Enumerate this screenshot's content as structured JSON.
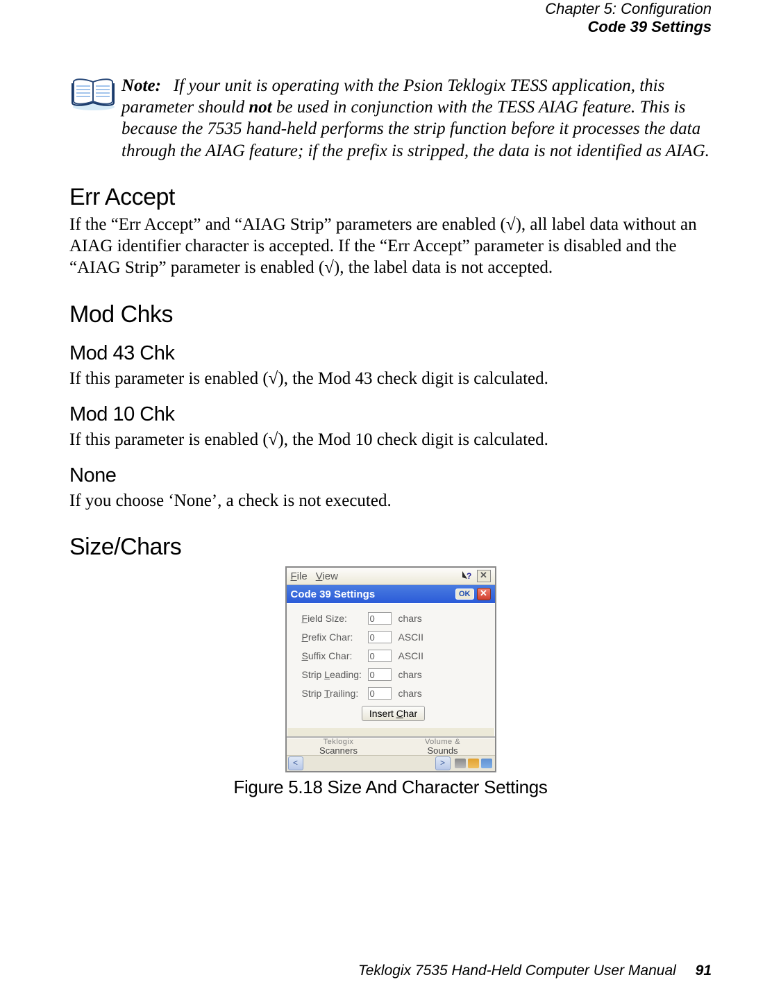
{
  "header": {
    "chapter": "Chapter 5: Configuration",
    "section": "Code 39 Settings"
  },
  "note": {
    "label": "Note:",
    "text_pre": "If your unit is operating with the Psion Teklogix TESS application, this parameter should ",
    "text_bold": "not",
    "text_post": " be used in conjunction with the TESS AIAG feature. This is because the 7535 hand-held performs the strip function before it processes the data through the AIAG feature; if the prefix is stripped, the data is not identified as AIAG."
  },
  "sections": {
    "err_accept": {
      "title": "Err Accept",
      "body": "If the “Err Accept” and “AIAG Strip” parameters are enabled (√), all label data without an AIAG identifier character is accepted. If the “Err Accept” parameter is disabled and the “AIAG Strip” parameter is enabled (√), the label data is not accepted."
    },
    "mod_chks": {
      "title": "Mod Chks"
    },
    "mod43": {
      "title": "Mod 43 Chk",
      "body": "If this parameter is enabled (√), the Mod 43 check digit is calculated."
    },
    "mod10": {
      "title": "Mod 10 Chk",
      "body": "If this parameter is enabled (√), the Mod 10 check digit is calculated."
    },
    "none": {
      "title": "None",
      "body": "If you choose ‘None’, a check is not executed."
    },
    "sizechars": {
      "title": "Size/Chars"
    }
  },
  "dialog": {
    "menu": {
      "file": "File",
      "view": "View"
    },
    "titlebar": {
      "title": "Code 39 Settings",
      "ok": "OK"
    },
    "rows": [
      {
        "label": "Field Size:",
        "value": "0",
        "unit": "chars"
      },
      {
        "label": "Prefix Char:",
        "value": "0",
        "unit": "ASCII"
      },
      {
        "label": "Suffix Char:",
        "value": "0",
        "unit": "ASCII"
      },
      {
        "label": "Strip Leading:",
        "value": "0",
        "unit": "chars"
      },
      {
        "label": "Strip Trailing:",
        "value": "0",
        "unit": "chars"
      }
    ],
    "insert_btn": "Insert Char",
    "taskbar": {
      "item1_top": "Teklogix",
      "item1_bot": "Scanners",
      "item2_top": "Volume &",
      "item2_bot": "Sounds"
    }
  },
  "figure_caption": "Figure 5.18 Size And Character Settings",
  "footer": {
    "manual": "Teklogix 7535 Hand-Held Computer User Manual",
    "page": "91"
  }
}
